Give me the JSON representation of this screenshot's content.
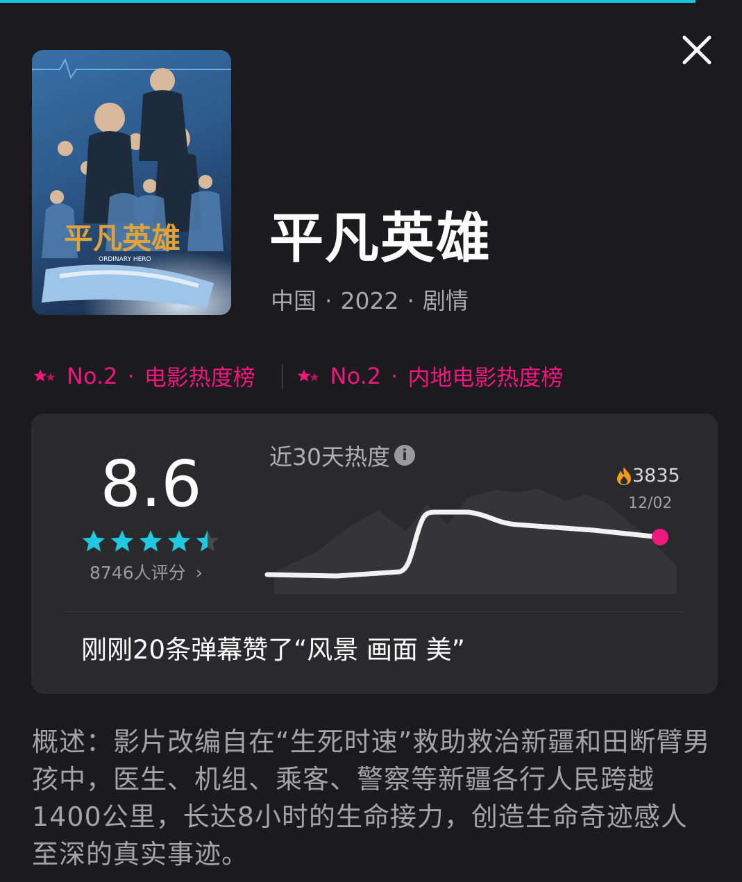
{
  "colors": {
    "accent_pink": "#f0177f",
    "star_cyan": "#20c8e0",
    "progress_bar": "#18c4d8",
    "background": "#1b1b1d",
    "card": "#2a2a2c"
  },
  "header": {
    "close_icon": "close-icon"
  },
  "movie": {
    "title": "平凡英雄",
    "country": "中国",
    "year": "2022",
    "genre": "剧情",
    "separator": "·",
    "poster": {
      "title_art": "平凡英雄",
      "subtitle_art": "ORDINARY HERO"
    }
  },
  "rankings": [
    {
      "rank": "No.2",
      "separator": "·",
      "list": "电影热度榜"
    },
    {
      "rank": "No.2",
      "separator": "·",
      "list": "内地电影热度榜"
    }
  ],
  "rating": {
    "score": "8.6",
    "stars": 4.5,
    "count_label": "8746人评分",
    "chevron": "›"
  },
  "heat": {
    "label": "近30天热度",
    "info_glyph": "i",
    "current_value": "3835",
    "current_date": "12/02"
  },
  "danmu": "刚刚20条弹幕赞了“风景 画面 美”",
  "description": "概述：影片改编自在“生死时速”救助救治新疆和田断臂男孩中，医生、机组、乘客、警察等新疆各行人民跨越1400公里，长达8小时的生命接力，创造生命奇迹感人至深的真实事迹。"
}
